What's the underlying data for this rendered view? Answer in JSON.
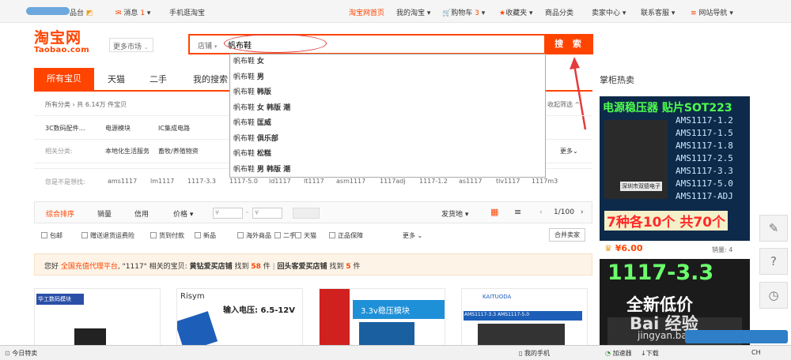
{
  "topbar": {
    "platform": "品台",
    "message_label": "消息",
    "message_count": "1",
    "mobile_taobao": "手机逛淘宝",
    "home": "淘宝网首页",
    "my_taobao": "我的淘宝",
    "cart": "购物车",
    "cart_count": "3",
    "favorites": "收藏夹",
    "categories": "商品分类",
    "seller_center": "卖家中心",
    "customer_service": "联系客服",
    "site_nav": "网站导航"
  },
  "logo": {
    "cn": "淘宝网",
    "en": "Taobao.com"
  },
  "more_markets": "更多市场",
  "search": {
    "scope": "店铺",
    "value": "帆布鞋",
    "button": "搜 索",
    "suggestions": [
      {
        "base": "帆布鞋",
        "extra": "女"
      },
      {
        "base": "帆布鞋",
        "extra": "男"
      },
      {
        "base": "帆布鞋",
        "extra": "韩版"
      },
      {
        "base": "帆布鞋",
        "extra": "女 韩版 潮"
      },
      {
        "base": "帆布鞋",
        "extra": "匡威"
      },
      {
        "base": "帆布鞋",
        "extra": "俱乐部"
      },
      {
        "base": "帆布鞋",
        "extra": "松糕"
      },
      {
        "base": "帆布鞋",
        "extra": "男 韩版 潮"
      }
    ]
  },
  "tabs": [
    "所有宝贝",
    "天猫",
    "二手",
    "我的搜索"
  ],
  "side_title": "掌柜热卖",
  "breadcrumb": "所有分类 › 共 6.14万 件宝贝",
  "collapse": "收起筛选 ^",
  "category_row": {
    "label": "3C数码配件…",
    "items": [
      "电源模块",
      "IC集成电路"
    ]
  },
  "related_row": {
    "label": "相关分类:",
    "items": [
      "本地化生活服务",
      "畜牧/养殖物资"
    ],
    "more": "更多"
  },
  "guess": {
    "label": "您是不是想找:",
    "items": [
      "ams1117",
      "lm1117",
      "1117-3.3",
      "1117-5.0",
      "ld1117",
      "lt1117",
      "asm1117",
      "1117adj",
      "1117-1.2",
      "as1117",
      "tlv1117",
      "1117m3"
    ]
  },
  "sort": {
    "items": [
      "综合排序",
      "销量",
      "信用",
      "价格"
    ],
    "price_from": "¥",
    "price_to": "¥",
    "location": "发货地",
    "page": "1/100"
  },
  "checks": [
    "包邮",
    "赠送退货运费险",
    "货到付款",
    "新品",
    "海外商品",
    "二手",
    "天猫",
    "正品保障"
  ],
  "checks_more": "更多",
  "merge_sellers": "合并卖家",
  "notice": {
    "prefix": "您好",
    "link": "全国充值代理平台",
    "mid": ", \"1117\" 相关的宝贝: ",
    "shop1": "黄钻爱买店铺",
    "found": " 找到 ",
    "count1": "58",
    "unit": " 件",
    "shop2": "回头客爱买店铺",
    "count2": "5"
  },
  "cards": [
    {
      "text": "华工数码模块"
    },
    {
      "text": "Risym",
      "sub": "输入电压: 6.5-12V"
    },
    {
      "text": "3.3v稳压模块"
    },
    {
      "text": "KAITUODA",
      "sub": "AMS1117-3.3  AMS1117-5.0"
    }
  ],
  "side_ads": {
    "ad1_title": "电源稳压器 贴片SOT223",
    "ad1_codes": [
      "AMS1117-1.2",
      "AMS1117-1.5",
      "AMS1117-1.8",
      "AMS1117-2.5",
      "AMS1117-3.3",
      "AMS1117-5.0",
      "AMS1117-ADJ"
    ],
    "ad1_seal": "深圳市双德电子",
    "ad1_promo": "7种各10个 共70个",
    "ad1_price": "¥6.00",
    "ad1_sales": "销量: 4",
    "ad2_title": "1117-3.3",
    "ad2_sub": "全新低价"
  },
  "float_buttons": [
    "✎",
    "?",
    "◷"
  ],
  "watermark": {
    "brand": "Bai 经验",
    "url": "jingyan.baidu.com"
  },
  "status": {
    "today": "今日特卖",
    "phone": "我的手机",
    "speed": "加速器",
    "download": "下载",
    "ime": "CH"
  },
  "colors": {
    "accent": "#ff4400",
    "annotation": "#e23c3c"
  }
}
